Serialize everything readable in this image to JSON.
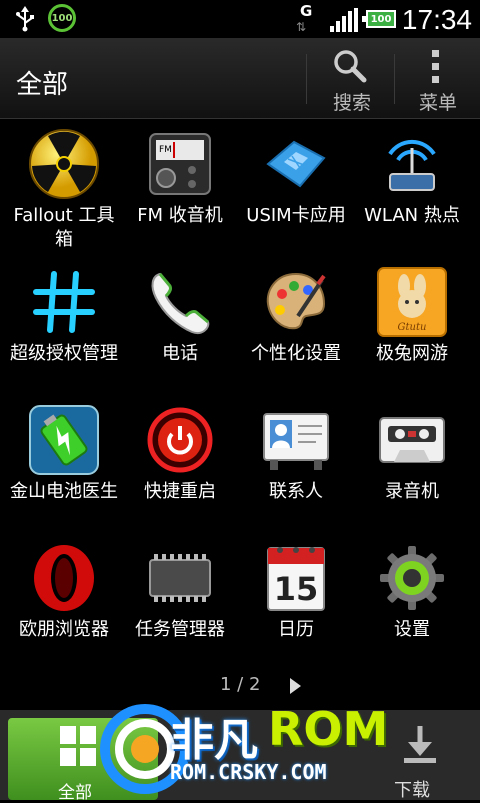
{
  "status_bar": {
    "battery_ring_text": "100",
    "network_type": "G",
    "battery_text": "100",
    "time": "17:34"
  },
  "header": {
    "title": "全部",
    "search_label": "搜索",
    "menu_label": "菜单"
  },
  "apps": [
    {
      "label": "Fallout 工具箱",
      "icon": "nuclear-icon"
    },
    {
      "label": "FM 收音机",
      "icon": "radio-icon"
    },
    {
      "label": "USIM卡应用",
      "icon": "sim-card-icon"
    },
    {
      "label": "WLAN 热点",
      "icon": "wifi-hotspot-icon"
    },
    {
      "label": "超级授权管理",
      "icon": "hash-icon"
    },
    {
      "label": "电话",
      "icon": "phone-icon"
    },
    {
      "label": "个性化设置",
      "icon": "palette-icon"
    },
    {
      "label": "极兔网游",
      "icon": "rabbit-icon",
      "icon_text": "Gtutu"
    },
    {
      "label": "金山电池医生",
      "icon": "battery-doctor-icon"
    },
    {
      "label": "快捷重启",
      "icon": "power-icon"
    },
    {
      "label": "联系人",
      "icon": "contacts-icon"
    },
    {
      "label": "录音机",
      "icon": "cassette-icon"
    },
    {
      "label": "欧朋浏览器",
      "icon": "opera-icon"
    },
    {
      "label": "任务管理器",
      "icon": "chip-icon"
    },
    {
      "label": "日历",
      "icon": "calendar-icon",
      "icon_text": "15"
    },
    {
      "label": "设置",
      "icon": "gear-icon"
    }
  ],
  "pager": {
    "text": "1 / 2"
  },
  "bottom_bar": {
    "all_label": "全部",
    "download_label": "下载"
  },
  "watermark": {
    "brand_cn": "非凡",
    "brand_en": "ROM",
    "url": "ROM.CRSKY.COM"
  },
  "colors": {
    "accent_green": "#7ac943",
    "background": "#000000"
  }
}
